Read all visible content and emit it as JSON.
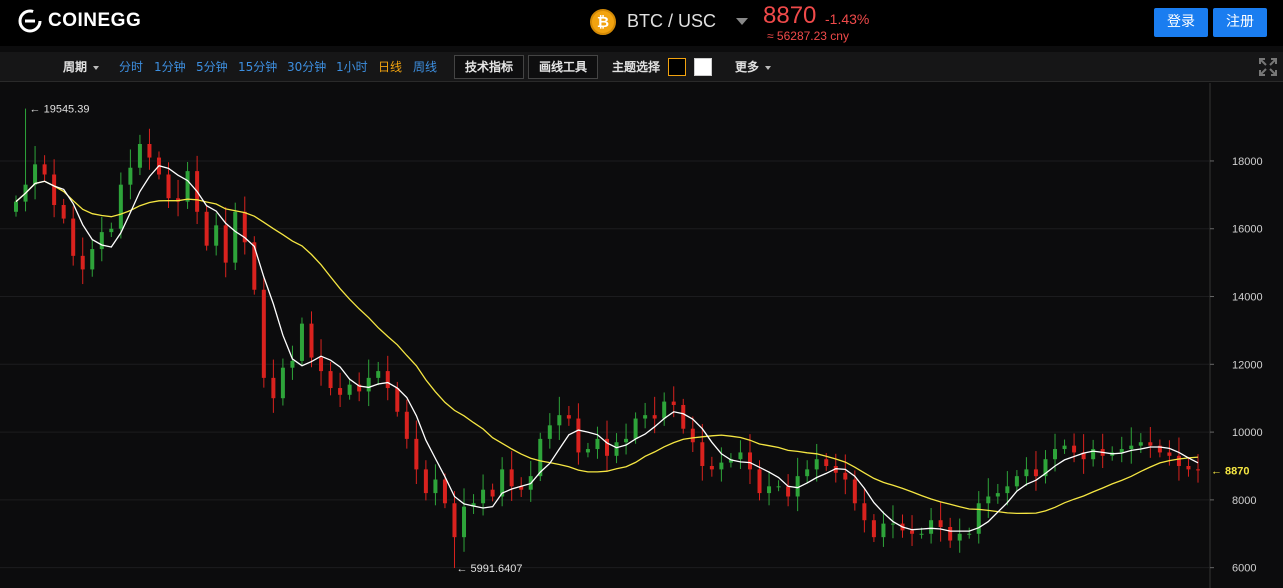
{
  "header": {
    "logo_text": "COINEGG",
    "coin_symbol": "₿",
    "pair_base": "BTC",
    "pair_sep": "/",
    "pair_quote": "USC",
    "price": "8870",
    "change": "-1.43%",
    "cny_price": "≈ 56287.23 cny",
    "login_label": "登录",
    "register_label": "注册"
  },
  "toolbar": {
    "period_label": "周期",
    "intervals": [
      "分时",
      "1分钟",
      "5分钟",
      "15分钟",
      "30分钟",
      "1小时",
      "日线",
      "周线"
    ],
    "active_interval": "日线",
    "indicator_label": "技术指标",
    "draw_tools_label": "画线工具",
    "theme_label": "主题选择",
    "more_label": "更多"
  },
  "colors": {
    "up": "#2ea43a",
    "down": "#d9221e",
    "ma_short": "#ffffff",
    "ma_long": "#f5e642",
    "accent": "#1a7df0",
    "active": "#f2a30f"
  },
  "chart_data": {
    "type": "candlestick",
    "y_ticks": [
      6000,
      8000,
      10000,
      12000,
      14000,
      16000,
      18000
    ],
    "ylim": [
      5400,
      20300
    ],
    "annotations": {
      "high": "19545.39",
      "low": "5991.6407",
      "last": "8870"
    },
    "close": [
      16800,
      17300,
      17900,
      17600,
      16700,
      16300,
      15200,
      14800,
      15400,
      15900,
      16000,
      17300,
      17800,
      18500,
      18100,
      17600,
      16900,
      16800,
      17700,
      16500,
      15500,
      16100,
      15000,
      16500,
      15600,
      14200,
      11600,
      11000,
      11900,
      12100,
      13200,
      12200,
      11800,
      11300,
      11100,
      11400,
      11200,
      11600,
      11800,
      11300,
      10600,
      9800,
      8900,
      8200,
      8600,
      7900,
      6900,
      7800,
      7900,
      8300,
      8100,
      8900,
      8400,
      8300,
      8700,
      9800,
      10200,
      10500,
      10400,
      9400,
      9500,
      9800,
      9300,
      9700,
      9800,
      10400,
      10500,
      10400,
      10900,
      10800,
      10100,
      9700,
      9000,
      8900,
      9100,
      9200,
      9400,
      8900,
      8200,
      8400,
      8400,
      8100,
      8700,
      8900,
      9200,
      9000,
      8800,
      8600,
      7900,
      7400,
      6900,
      7300,
      7300,
      7100,
      7000,
      7000,
      7400,
      7200,
      6800,
      7000,
      7000,
      7900,
      8100,
      8200,
      8400,
      8700,
      8900,
      8700,
      9200,
      9500,
      9600,
      9400,
      9200,
      9500,
      9300,
      9400,
      9500,
      9600,
      9700,
      9600,
      9400,
      9300,
      9000,
      8900,
      8870
    ]
  }
}
